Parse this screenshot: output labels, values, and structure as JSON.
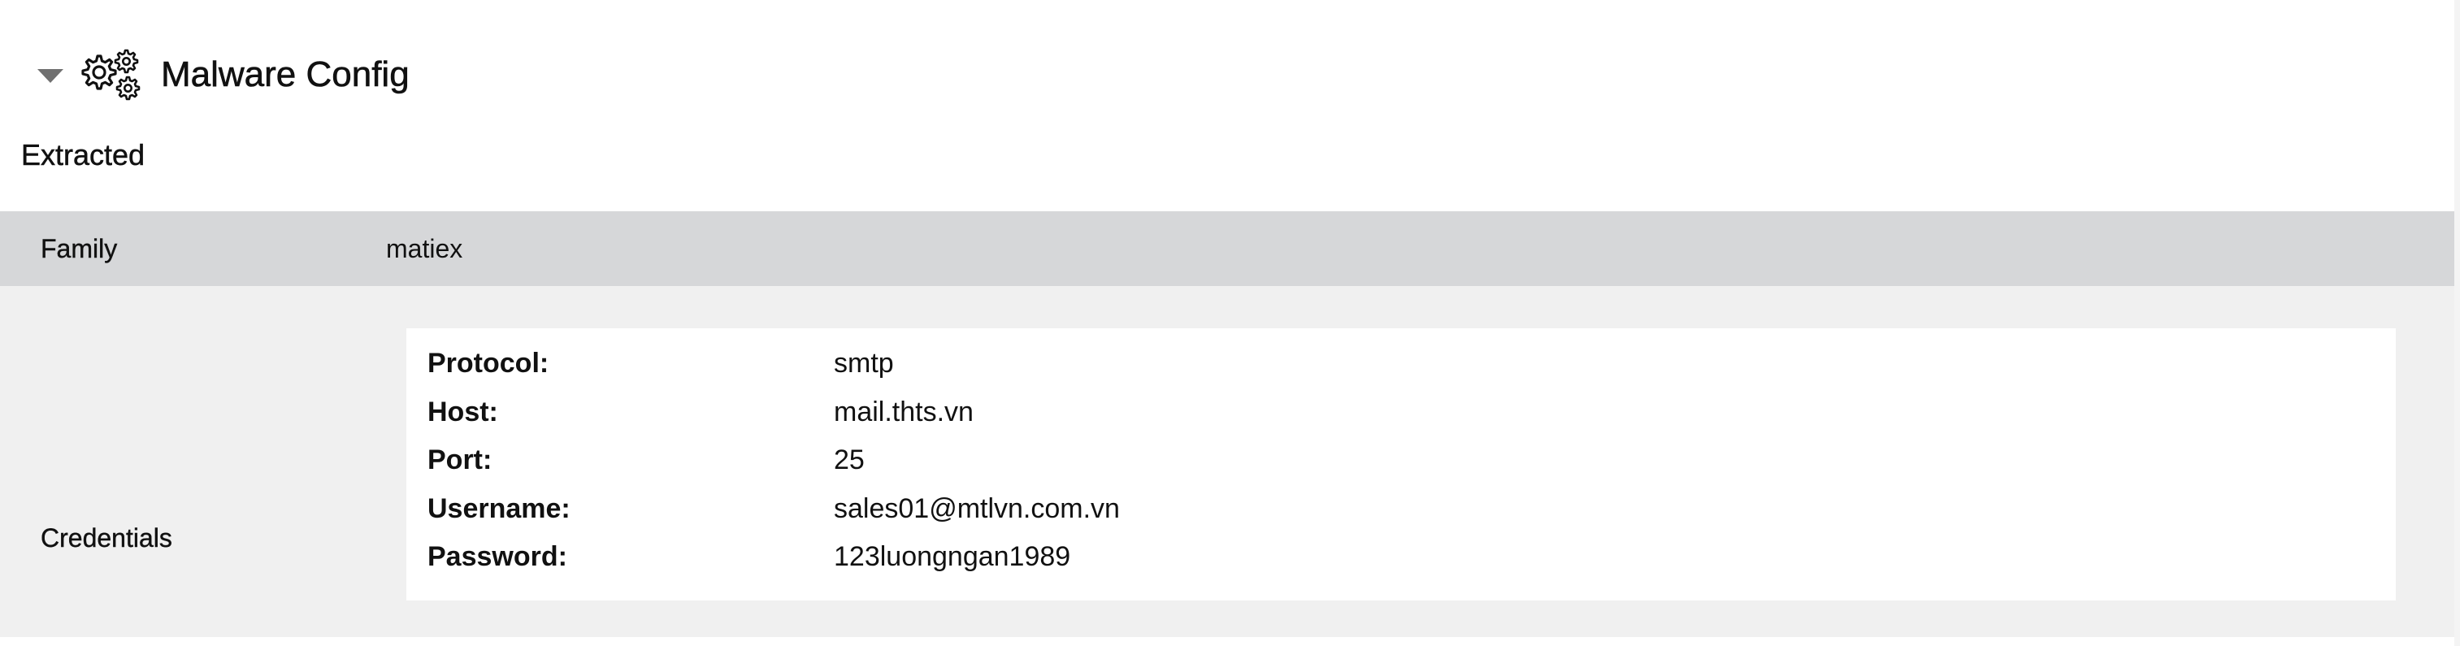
{
  "header": {
    "title": "Malware Config",
    "icon": "gears-icon",
    "toggle_icon": "caret-down-icon"
  },
  "subheading": "Extracted",
  "rows": {
    "family": {
      "key": "Family",
      "value": "matiex"
    },
    "credentials": {
      "key": "Credentials",
      "entries": [
        {
          "label": "Protocol:",
          "value": "smtp"
        },
        {
          "label": "Host:",
          "value": "mail.thts.vn"
        },
        {
          "label": "Port:",
          "value": "25"
        },
        {
          "label": "Username:",
          "value": "sales01@mtlvn.com.vn"
        },
        {
          "label": "Password:",
          "value": "123luongngan1989"
        }
      ]
    }
  },
  "colors": {
    "family_row_bg": "#d6d7d9",
    "credentials_row_bg": "#f0f0f0",
    "card_bg": "#ffffff",
    "caret": "#707070"
  }
}
